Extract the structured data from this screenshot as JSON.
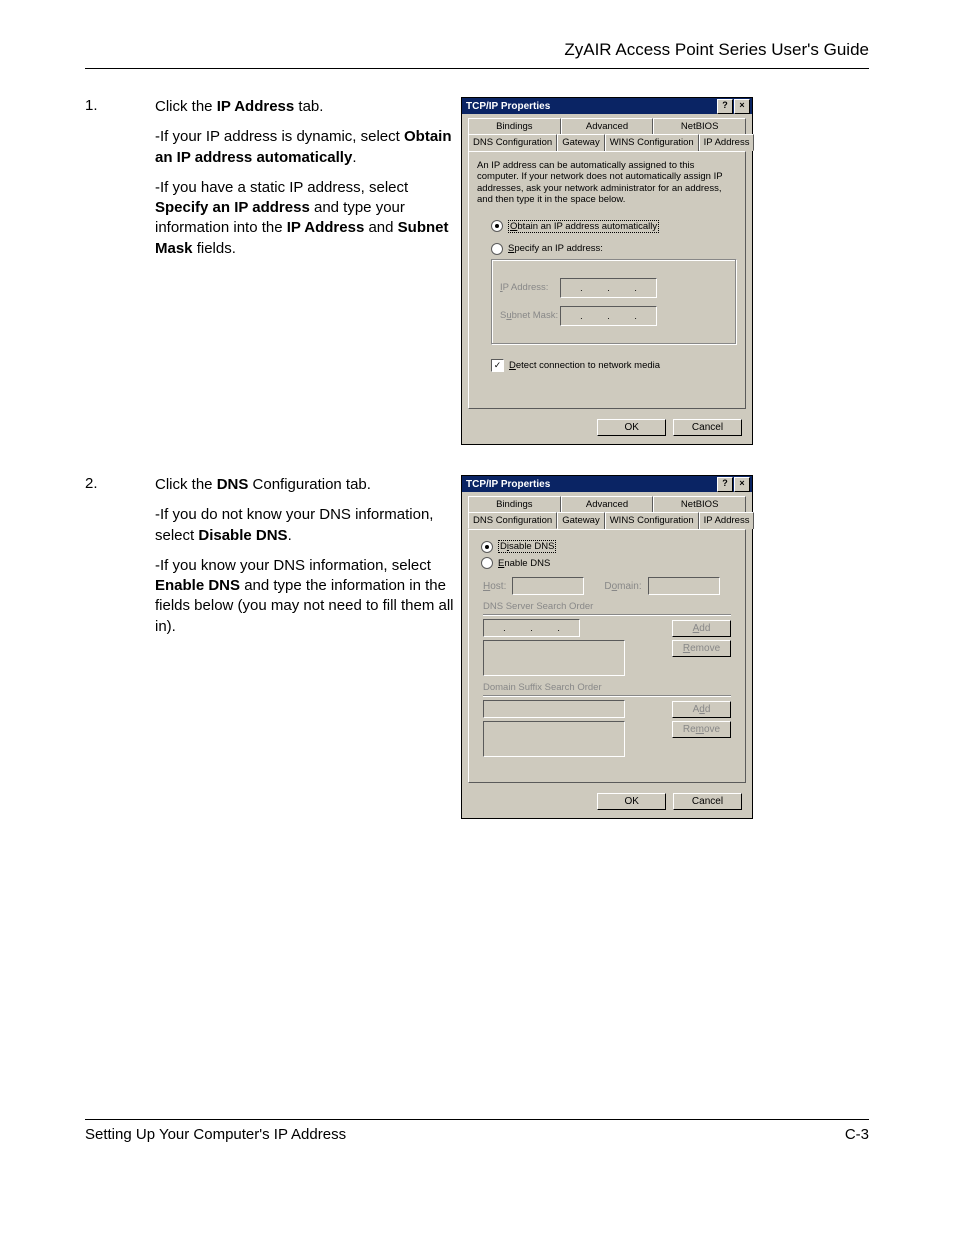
{
  "header": "ZyAIR Access Point Series User's Guide",
  "steps": {
    "s1": {
      "num": "1.",
      "line1_a": "Click the ",
      "line1_b": "IP Address",
      "line1_c": " tab.",
      "p2_a": "-If your IP address is dynamic, select ",
      "p2_b": "Obtain an IP address automatically",
      "p2_c": ".",
      "p3_a": "-If you have a static IP address, select ",
      "p3_b": "Specify an IP address",
      "p3_c": " and type your information into the ",
      "p3_d": "IP Address",
      "p3_e": " and ",
      "p3_f": "Subnet Mask",
      "p3_g": " fields."
    },
    "s2": {
      "num": "2.",
      "line1_a": "Click the ",
      "line1_b": "DNS",
      "line1_c": " Configuration tab.",
      "p2_a": "-If you do not know your DNS information, select ",
      "p2_b": "Disable DNS",
      "p2_c": ".",
      "p3_a": "-If you know your DNS information, select ",
      "p3_b": "Enable DNS",
      "p3_c": " and type the information in the fields below (you may not need to fill them all in)."
    }
  },
  "dialog1": {
    "title": "TCP/IP Properties",
    "tabs_top": [
      "Bindings",
      "Advanced",
      "NetBIOS"
    ],
    "tabs_bottom": [
      "DNS Configuration",
      "Gateway",
      "WINS Configuration",
      "IP Address"
    ],
    "desc": "An IP address can be automatically assigned to this computer. If your network does not automatically assign IP addresses, ask your network administrator for an address, and then type it in the space below.",
    "radio_obtain": "Obtain an IP address automatically",
    "radio_specify": "Specify an IP address:",
    "ip_label": "IP Address:",
    "subnet_label": "Subnet Mask:",
    "check_detect": "Detect connection to network media",
    "ok": "OK",
    "cancel": "Cancel"
  },
  "dialog2": {
    "title": "TCP/IP Properties",
    "tabs_top": [
      "Bindings",
      "Advanced",
      "NetBIOS"
    ],
    "tabs_bottom": [
      "DNS Configuration",
      "Gateway",
      "WINS Configuration",
      "IP Address"
    ],
    "radio_disable": "Disable DNS",
    "radio_enable": "Enable DNS",
    "host": "Host:",
    "domain": "Domain:",
    "dns_order": "DNS Server Search Order",
    "suffix_order": "Domain Suffix Search Order",
    "add": "Add",
    "remove": "Remove",
    "ok": "OK",
    "cancel": "Cancel"
  },
  "footer": {
    "left": "Setting Up Your Computer's IP Address",
    "right": "C-3"
  }
}
